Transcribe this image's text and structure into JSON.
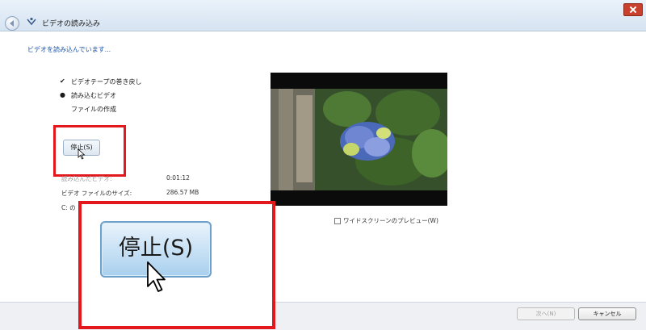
{
  "window": {
    "title": "ビデオの読み込み"
  },
  "heading": "ビデオを読み込んでいます...",
  "steps": [
    {
      "mark": "✔",
      "label": "ビデオテープの巻き戻し"
    },
    {
      "mark": "●",
      "label": "読み込むビデオ"
    },
    {
      "mark": "",
      "label": "ファイルの作成"
    }
  ],
  "stop_button": {
    "label": "停止(S)"
  },
  "stats": {
    "elapsed_label": "読み込んだビデオ:",
    "elapsed_value": "0:01:12",
    "size_label": "ビデオ ファイルのサイズ:",
    "size_value": "286.57 MB",
    "drive_label": "C: の"
  },
  "widescreen_preview": {
    "label": "ワイドスクリーンのプレビュー(W)",
    "checked": false
  },
  "footer": {
    "next_label": "次へ(N)",
    "cancel_label": "キャンセル"
  },
  "zoom": {
    "stop_label": "停止(S)"
  },
  "colors": {
    "highlight": "#e3181d",
    "heading": "#1a53a8"
  }
}
